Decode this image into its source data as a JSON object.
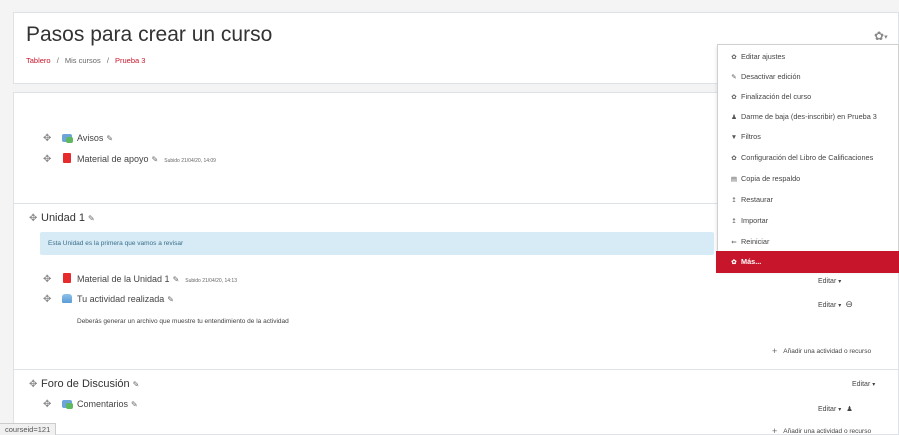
{
  "header": {
    "title": "Pasos para crear un curso",
    "breadcrumb": [
      "Tablero",
      "Mis cursos",
      "Prueba 3"
    ],
    "separator": "/"
  },
  "actions_menu": {
    "items": [
      {
        "icon": "gear-icon",
        "glyph": "✿",
        "label": "Editar ajustes"
      },
      {
        "icon": "pencil-icon",
        "glyph": "✎",
        "label": "Desactivar edición"
      },
      {
        "icon": "gear-icon",
        "glyph": "✿",
        "label": "Finalización del curso"
      },
      {
        "icon": "user-icon",
        "glyph": "♟",
        "label": "Darme de baja (des-inscribir) en Prueba 3"
      },
      {
        "icon": "filter-icon",
        "glyph": "▼",
        "label": "Filtros"
      },
      {
        "icon": "gear-icon",
        "glyph": "✿",
        "label": "Configuración del Libro de Calificaciones"
      },
      {
        "icon": "file-icon",
        "glyph": "▤",
        "label": "Copia de respaldo"
      },
      {
        "icon": "upload-icon",
        "glyph": "↥",
        "label": "Restaurar"
      },
      {
        "icon": "upload-icon",
        "glyph": "↥",
        "label": "Importar"
      },
      {
        "icon": "reset-icon",
        "glyph": "⇐",
        "label": "Reiniciar"
      },
      {
        "icon": "gear-icon",
        "glyph": "✿",
        "label": "Más..."
      }
    ]
  },
  "course": {
    "general_items": [
      {
        "type": "forum",
        "name": "Avisos",
        "meta": ""
      },
      {
        "type": "pdf",
        "name": "Material de apoyo",
        "meta": "Subido 21/04/20, 14:09"
      }
    ],
    "sections": [
      {
        "name": "Unidad 1",
        "summary": "Esta Unidad es la primera que vamos a revisar",
        "items": [
          {
            "type": "pdf",
            "name": "Material de la Unidad 1",
            "meta": "Subido 21/04/20, 14:13",
            "edit": "Editar"
          },
          {
            "type": "assign",
            "name": "Tu actividad realizada",
            "description": "Deberás generar un archivo que muestre tu entendimiento de la actividad",
            "edit": "Editar"
          }
        ],
        "add_label": "Añadir una actividad o recurso"
      },
      {
        "name": "Foro de Discusión",
        "edit": "Editar",
        "items": [
          {
            "type": "forum",
            "name": "Comentarios",
            "edit": "Editar"
          }
        ],
        "add_label": "Añadir una actividad o recurso"
      }
    ]
  },
  "status_bar": {
    "text": "courseid=121"
  }
}
